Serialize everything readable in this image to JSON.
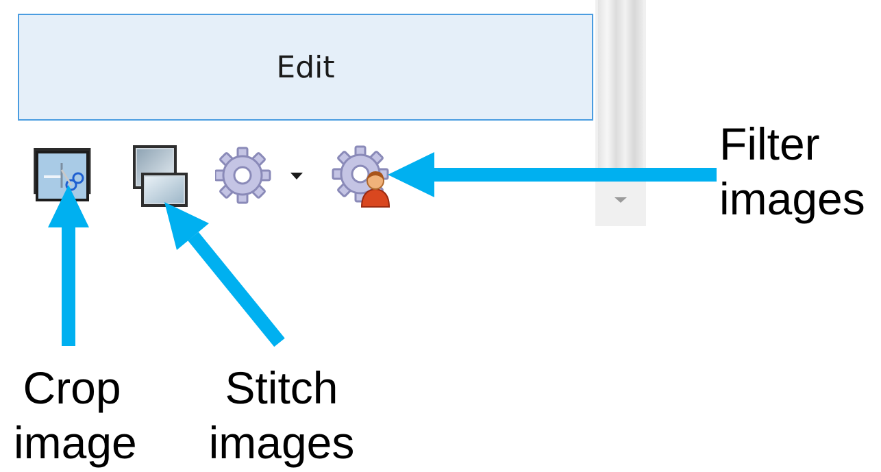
{
  "toolbar": {
    "tab_label": "Edit",
    "buttons": [
      {
        "id": "crop",
        "icon": "crop-scissors-icon"
      },
      {
        "id": "stitch",
        "icon": "stitch-images-icon"
      },
      {
        "id": "settings",
        "icon": "gear-dropdown-icon"
      },
      {
        "id": "filter",
        "icon": "gear-person-icon"
      }
    ]
  },
  "callouts": {
    "filter": {
      "line1": "Filter",
      "line2": "images"
    },
    "crop": {
      "line1": "Crop",
      "line2": "image"
    },
    "stitch": {
      "line1": "Stitch",
      "line2": "images"
    }
  },
  "colors": {
    "arrow": "#00b0f0",
    "tab_background": "#e5eff9",
    "tab_border": "#4a9ce0"
  }
}
